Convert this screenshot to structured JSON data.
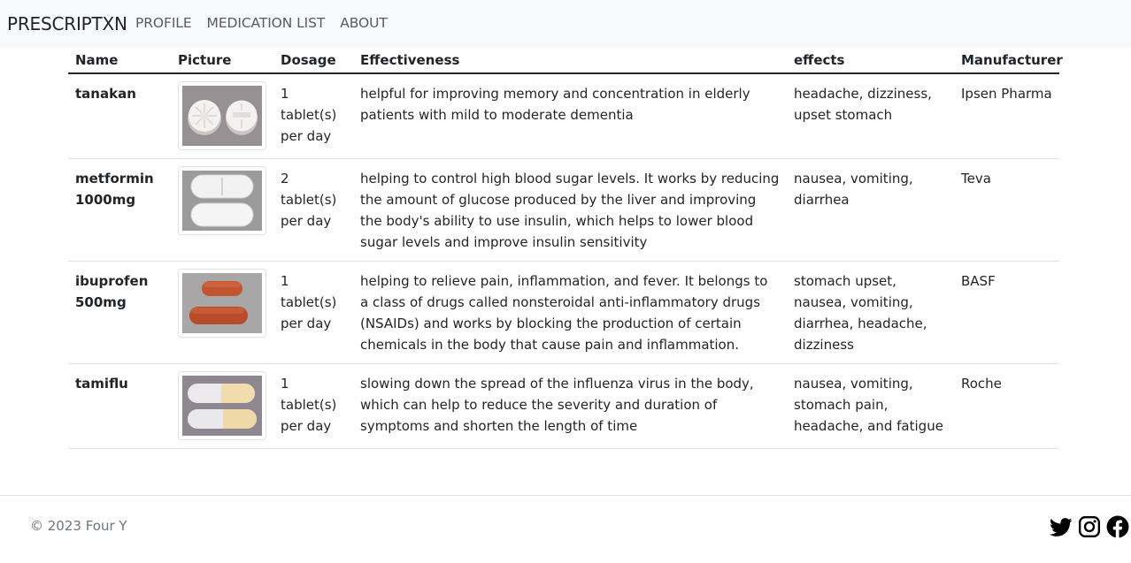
{
  "navbar": {
    "brand": "PRESCRIPTXN",
    "links": [
      "PROFILE",
      "MEDICATION LIST",
      "ABOUT"
    ]
  },
  "table": {
    "headers": [
      "Name",
      "Picture",
      "Dosage",
      "Effectiveness",
      "effects",
      "Manufacturer"
    ],
    "rows": [
      {
        "name": "tanakan",
        "picture_icon": "tanakan-pill-image",
        "dosage": "1 tablet(s) per day",
        "effectiveness": "helpful for improving memory and concentration in elderly patients with mild to moderate dementia",
        "effects": "headache, dizziness, upset stomach",
        "manufacturer": "Ipsen Pharma"
      },
      {
        "name": "metformin 1000mg",
        "picture_icon": "metformin-pill-image",
        "dosage": "2 tablet(s) per day",
        "effectiveness": "helping to control high blood sugar levels. It works by reducing the amount of glucose produced by the liver and improving the body's ability to use insulin, which helps to lower blood sugar levels and improve insulin sensitivity",
        "effects": "nausea, vomiting, diarrhea",
        "manufacturer": "Teva"
      },
      {
        "name": "ibuprofen 500mg",
        "picture_icon": "ibuprofen-pill-image",
        "dosage": "1 tablet(s) per day",
        "effectiveness": "helping to relieve pain, inflammation, and fever. It belongs to a class of drugs called nonsteroidal anti-inflammatory drugs (NSAIDs) and works by blocking the production of certain chemicals in the body that cause pain and inflammation.",
        "effects": "stomach upset, nausea, vomiting, diarrhea, headache, dizziness",
        "manufacturer": "BASF"
      },
      {
        "name": "tamiflu",
        "picture_icon": "tamiflu-capsule-image",
        "dosage": "1 tablet(s) per day",
        "effectiveness": "slowing down the spread of the influenza virus in the body, which can help to reduce the severity and duration of symptoms and shorten the length of time",
        "effects": "nausea, vomiting, stomach pain, headache, and fatigue",
        "manufacturer": "Roche"
      }
    ]
  },
  "footer": {
    "copyright": "© 2023 Four Y",
    "social_icons": [
      "twitter-icon",
      "instagram-icon",
      "facebook-icon"
    ]
  },
  "colors": {
    "navbar_bg": "#f8f9fa",
    "text": "#212529",
    "muted": "#6c757d",
    "border": "#dee2e6"
  }
}
